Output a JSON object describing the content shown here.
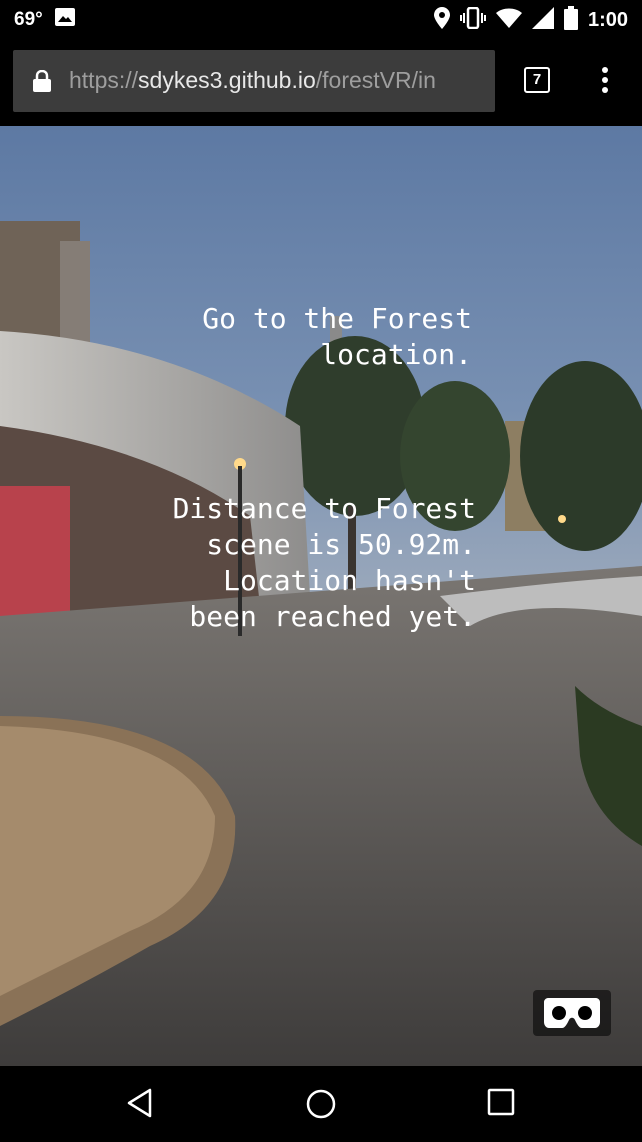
{
  "status_bar": {
    "temperature": "69°",
    "time": "1:00",
    "icons": [
      "image-icon",
      "location-icon",
      "vibrate-icon",
      "wifi-icon",
      "signal-icon",
      "battery-icon"
    ]
  },
  "browser": {
    "url_scheme": "https://",
    "url_host": "sdykes3.github.io",
    "url_path": "/forestVR/in",
    "tab_count": "7"
  },
  "scene": {
    "heading": "Go to the Forest\nlocation.",
    "distance_message": "Distance to Forest\nscene is 50.92m.\nLocation hasn't\nbeen reached yet."
  },
  "nav_bar": {
    "buttons": [
      "back-icon",
      "home-icon",
      "recents-icon"
    ]
  },
  "colors": {
    "sky": "#6f86a8",
    "toolbar": "#000000",
    "url_box": "#3c3c3c"
  }
}
